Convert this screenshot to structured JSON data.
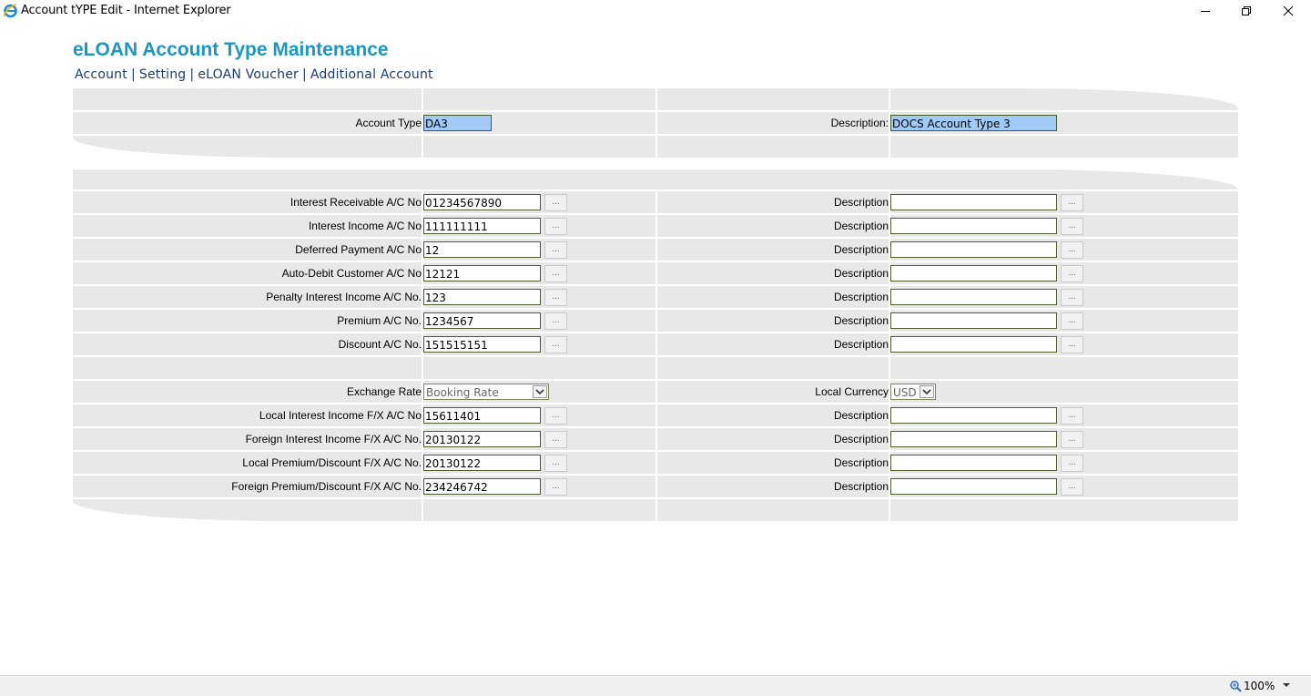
{
  "window": {
    "title": "Account tYPE Edit - Internet Explorer"
  },
  "page": {
    "heading": "eLOAN Account Type Maintenance",
    "nav": [
      "Account",
      "Setting",
      "eLOAN Voucher",
      "Additional Account"
    ]
  },
  "header_form": {
    "account_type_label": "Account Type",
    "account_type_value": "DA3",
    "description_label": "Description:",
    "description_value": "DOCS Account Type 3"
  },
  "accounts": [
    {
      "label": "Interest Receivable A/C No",
      "value": "01234567890",
      "desc_label": "Description",
      "desc_value": ""
    },
    {
      "label": "Interest Income A/C No",
      "value": "111111111",
      "desc_label": "Description",
      "desc_value": ""
    },
    {
      "label": "Deferred Payment A/C No",
      "value": "12",
      "desc_label": "Description",
      "desc_value": ""
    },
    {
      "label": "Auto-Debit Customer A/C No",
      "value": "12121",
      "desc_label": "Description",
      "desc_value": ""
    },
    {
      "label": "Penalty Interest Income A/C No.",
      "value": "123",
      "desc_label": "Description",
      "desc_value": ""
    },
    {
      "label": "Premium A/C No.",
      "value": "1234567",
      "desc_label": "Description",
      "desc_value": ""
    },
    {
      "label": "Discount A/C No.",
      "value": "151515151",
      "desc_label": "Description",
      "desc_value": ""
    }
  ],
  "exchange": {
    "rate_label": "Exchange Rate",
    "rate_value": "Booking Rate",
    "currency_label": "Local Currency",
    "currency_value": "USD"
  },
  "fx_accounts": [
    {
      "label": "Local Interest Income F/X A/C No",
      "value": "15611401",
      "desc_label": "Description",
      "desc_value": ""
    },
    {
      "label": "Foreign Interest Income F/X A/C No.",
      "value": "20130122",
      "desc_label": "Description",
      "desc_value": ""
    },
    {
      "label": "Local Premium/Discount F/X A/C No.",
      "value": "20130122",
      "desc_label": "Description",
      "desc_value": ""
    },
    {
      "label": "Foreign Premium/Discount F/X A/C No.",
      "value": "234246742",
      "desc_label": "Description",
      "desc_value": ""
    }
  ],
  "lookup_button_label": "...",
  "statusbar": {
    "zoom": "100%"
  },
  "colors": {
    "heading": "#1a96c7",
    "nav": "#1b3d6e",
    "highlight_field": "#9fcbf6",
    "panel": "#e8e8e8"
  }
}
